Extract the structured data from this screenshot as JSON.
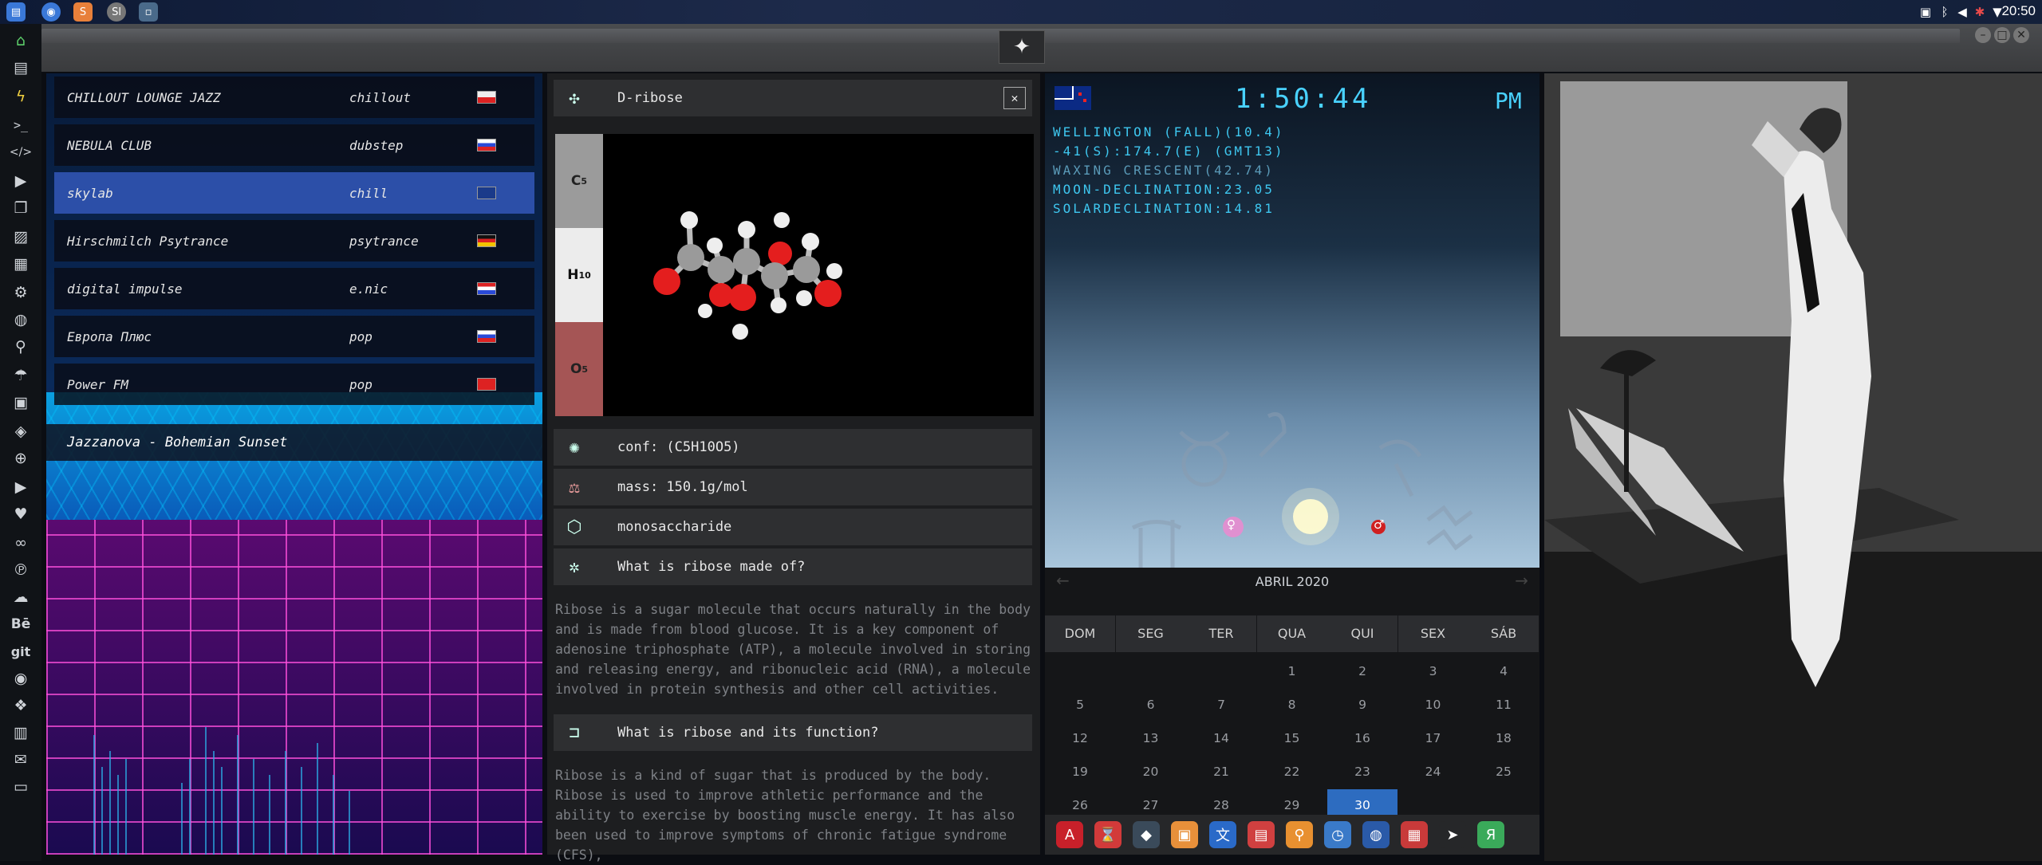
{
  "topbar": {
    "clock": "20:50",
    "apps": [
      "files-icon",
      "chrome-icon",
      "sublime-icon",
      "sl-icon",
      "window-icon"
    ],
    "tray": [
      "image-icon",
      "bluetooth-icon",
      "volume-icon",
      "bug-icon",
      "wifi-icon",
      "power-icon"
    ]
  },
  "dock": {
    "items": [
      "home-icon",
      "document-icon",
      "bolt-icon",
      "terminal-icon",
      "code-icon",
      "play-icon",
      "copy-icon",
      "image-icon",
      "table-icon",
      "gear-icon",
      "compass-icon",
      "search-icon",
      "umbrella-icon",
      "briefcase-icon",
      "tags-icon",
      "crosshair-icon",
      "youtube-icon",
      "heart-icon",
      "link-icon",
      "pinterest-icon",
      "cloud-icon",
      "behance-icon",
      "git-icon",
      "github-icon",
      "dropbox-icon",
      "map-icon",
      "mail-icon",
      "window-icon"
    ],
    "labels": {
      "behance": "Bē",
      "git": "git"
    }
  },
  "radio": {
    "stations": [
      {
        "name": "CHILLOUT LOUNGE JAZZ",
        "genre": "chillout",
        "flag": "pl"
      },
      {
        "name": "NEBULA CLUB",
        "genre": "dubstep",
        "flag": "ru"
      },
      {
        "name": "skylab",
        "genre": "chill",
        "flag": "gb"
      },
      {
        "name": "Hirschmilch Psytrance",
        "genre": "psytrance",
        "flag": "de"
      },
      {
        "name": "digital impulse",
        "genre": "e.nic",
        "flag": "hr"
      },
      {
        "name": "Европа Плюс",
        "genre": "pop",
        "flag": "ru"
      },
      {
        "name": "Power FM",
        "genre": "pop",
        "flag": "tr"
      }
    ],
    "selected_index": 2,
    "now_playing": "Jazzanova - Bohemian Sunset"
  },
  "chem": {
    "title": "D-ribose",
    "elements": [
      {
        "symbol": "C",
        "count": "5",
        "color": "#9b9b9b"
      },
      {
        "symbol": "H",
        "count": "10",
        "color": "#ececec"
      },
      {
        "symbol": "O",
        "count": "5",
        "color": "#a55555"
      }
    ],
    "conf_label": "conf: ",
    "conf": "(C5H10O5)",
    "mass": "mass: 150.1g/mol",
    "class": "monosaccharide",
    "q1": "What is ribose made of?",
    "a1": "Ribose is a sugar molecule that occurs naturally in the body and is made from blood glucose. It is a key component of adenosine triphosphate (ATP), a molecule involved in storing and releasing energy, and ribonucleic acid (RNA), a molecule involved in protein synthesis and other cell activities.",
    "q2": "What is ribose and its function?",
    "a2": "Ribose is a kind of sugar that is produced by the body. Ribose is used to improve athletic performance and the ability to exercise by boosting muscle energy. It has also been used to improve symptoms of chronic fatigue syndrome (CFS),"
  },
  "astro": {
    "time": "1:50:44",
    "ampm": "PM",
    "lines": [
      "WELLINGTON (FALL)(10.4)",
      "-41(S):174.7(E) (GMT13)",
      "WAXING CRESCENT(42.74)",
      "MOON-DECLINATION:23.05",
      "SOLARDECLINATION:14.81"
    ],
    "venus_symbol": "♀",
    "mars_symbol": "♂"
  },
  "calendar": {
    "title": "ABRIL 2020",
    "dow": [
      "DOM",
      "SEG",
      "TER",
      "QUA",
      "QUI",
      "SEX",
      "SÁB"
    ],
    "weeks": [
      [
        "",
        "",
        "",
        "1",
        "2",
        "3",
        "4"
      ],
      [
        "5",
        "6",
        "7",
        "8",
        "9",
        "10",
        "11"
      ],
      [
        "12",
        "13",
        "14",
        "15",
        "16",
        "17",
        "18"
      ],
      [
        "19",
        "20",
        "21",
        "22",
        "23",
        "24",
        "25"
      ],
      [
        "26",
        "27",
        "28",
        "29",
        "30",
        "",
        ""
      ]
    ],
    "today": "30"
  },
  "appdock": {
    "items": [
      {
        "name": "adobe-icon",
        "color": "#c8202a",
        "glyph": "A"
      },
      {
        "name": "hourglass-icon",
        "color": "#d23a3a",
        "glyph": "⌛"
      },
      {
        "name": "gem-icon",
        "color": "#3a4a5a",
        "glyph": "◆"
      },
      {
        "name": "photos-icon",
        "color": "#e8903a",
        "glyph": "▣"
      },
      {
        "name": "translate-icon",
        "color": "#2a6ac8",
        "glyph": "文"
      },
      {
        "name": "news-icon",
        "color": "#d04040",
        "glyph": "▤"
      },
      {
        "name": "search-app-icon",
        "color": "#e89030",
        "glyph": "⚲"
      },
      {
        "name": "clock-icon",
        "color": "#3a7ac8",
        "glyph": "◷"
      },
      {
        "name": "globe-icon",
        "color": "#2a5aa8",
        "glyph": "◍"
      },
      {
        "name": "calendar-icon",
        "color": "#c83a3a",
        "glyph": "▦"
      },
      {
        "name": "arrow-icon",
        "color": "#262729",
        "glyph": "➤"
      },
      {
        "name": "yandex-icon",
        "color": "#3aaa5a",
        "glyph": "Я"
      }
    ]
  }
}
